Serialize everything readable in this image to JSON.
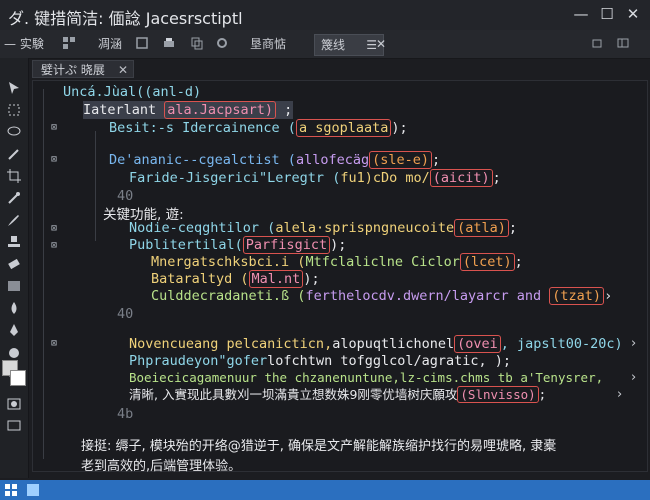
{
  "window": {
    "title": "ダ. 键措简洁: 偭諗 Jacesrsctiptl",
    "min_label": "—",
    "max_label": "☐",
    "close_label": "✕"
  },
  "toolbar": {
    "item1": "— 实験",
    "item2": "凋涵",
    "item3": "垦商惦",
    "tab_active": "篾线",
    "menu_glyph": "☰",
    "close_glyph": "✕"
  },
  "panel": {
    "tab_label": "嬖计ぷ 晓展",
    "tab_close": "✕"
  },
  "code": {
    "l1": "Uncá.Jùal((anl-d)",
    "l2a": "Iaterlant",
    "l2b": "ala.Jacpsart)",
    "l2c": ";",
    "l3a": "Besit:-s Idercainence (",
    "l3b": "a sgoplaata",
    "l3c": ");",
    "l4a": "De'ananic--cgealctist (",
    "l4b": "allofecäg",
    "l4c": "(sle-e)",
    "l4d": ";",
    "l5a": "Faride-Jisgerici\"Leregtr (",
    "l5b": "fu1)cDo mo/",
    "l5c": "(aicit)",
    "l5d": ";",
    "l6": "40",
    "l7": "关键功能, 遊:",
    "l8a": "Nodie-ceqghtilor (",
    "l8b": "alela·sprispngneucoite",
    "l8c": "(atla)",
    "l8d": ";",
    "l9a": "Publitertilal(",
    "l9b": "Parfisgict",
    "l9c": ");",
    "l10a": "Mnergatschksbci.i (",
    "l10b": "Mtfclaliclne Ciclor",
    "l10c": "(lcet)",
    "l10d": ";",
    "l11a": "Bataraltyd (",
    "l11b": "Mal.nt",
    "l11c": ");",
    "l12a": "Culddecradaneti.ß (",
    "l12b": "ferthelocdv.dwern/layarcr and",
    "l12c": "(tzat)",
    "l12d": "›",
    "l13": "40",
    "l14a": "Novencueang pelcanicticn,",
    "l14b": "alopuqtlichonel",
    "l14c": "(ovei",
    "l14d": ", japslt00-20c)",
    "l14e": "›",
    "l15a": "Phpraudeyon\"gofer",
    "l15b": "lofchtwn tofgglcol/agratic",
    "l15c": ", );",
    "l16a": "Boeiecicagamenuur the chzanenuntune,lz-cims.chms tb a'Tenysrer,",
    "l16b": "›",
    "l17a": "清晰, 入實现此具數刈一坝滿貴立想数姝9刚零优墙树庆願攻",
    "l17b": "(Slnvisso)",
    "l17c": ";",
    "l17d": "›",
    "l18": "4b",
    "l19": "接挺: 缛子, 模块殆的开络@猎逆于, 确保是文产解能解族缩护找行的易哩琥略, 隶橐",
    "l20": "老到高效的,后端管理体验。"
  },
  "colors": {
    "editor_bg": "#1a1b1f",
    "box_red": "#d9534f",
    "taskbar": "#2b6fbf"
  }
}
